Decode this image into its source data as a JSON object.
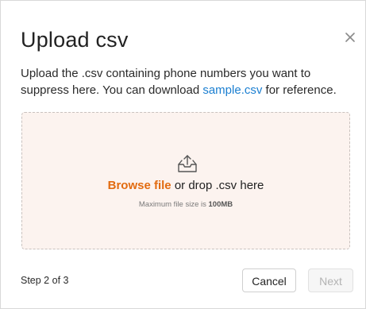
{
  "modal": {
    "title": "Upload csv",
    "close_icon": "close-icon",
    "description": {
      "text_before": "Upload the .csv containing phone numbers you want to suppress here. You can download ",
      "link_text": "sample.csv",
      "text_after": " for reference."
    }
  },
  "dropzone": {
    "icon": "upload-tray-icon",
    "browse_label": "Browse file",
    "drop_text": " or drop .csv here",
    "size_prefix": "Maximum file size is ",
    "size_value": "100MB",
    "background_color": "#fcf3ef",
    "accent_color": "#e26b10"
  },
  "footer": {
    "step_text": "Step 2 of 3",
    "cancel_label": "Cancel",
    "next_label": "Next",
    "next_disabled": true
  },
  "colors": {
    "link": "#1b7fd1",
    "browse": "#e26b10",
    "disabled_text": "#b3b3b3"
  }
}
